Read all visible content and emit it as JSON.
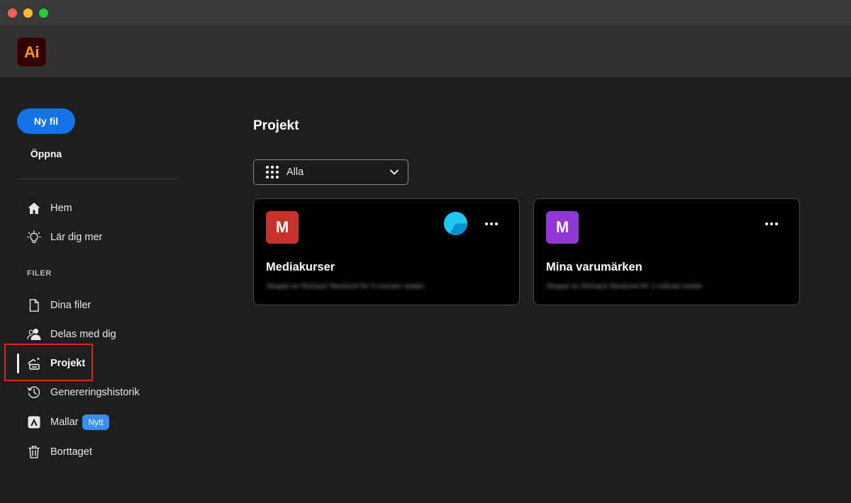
{
  "app": {
    "logo_text": "Ai",
    "brand_color": "#ff9a00",
    "accent_color": "#1473e6"
  },
  "sidebar": {
    "new_file_label": "Ny fil",
    "open_label": "Öppna",
    "nav_top": [
      {
        "label": "Hem",
        "icon": "home-icon"
      },
      {
        "label": "Lär dig mer",
        "icon": "lightbulb-icon"
      }
    ],
    "files_section_label": "FILER",
    "nav_files": [
      {
        "label": "Dina filer",
        "icon": "document-icon"
      },
      {
        "label": "Delas med dig",
        "icon": "people-icon"
      },
      {
        "label": "Projekt",
        "icon": "project-icon",
        "active": true
      },
      {
        "label": "Genereringshistorik",
        "icon": "history-icon"
      },
      {
        "label": "Mallar",
        "icon": "template-icon",
        "badge": "Nytt"
      },
      {
        "label": "Borttaget",
        "icon": "trash-icon"
      }
    ]
  },
  "main": {
    "title": "Projekt",
    "filter": {
      "label": "Alla",
      "icon": "grid-icon"
    },
    "projects": [
      {
        "initial": "M",
        "name": "Mediakurser",
        "subtitle": "Skapat av Richard Stenlund för 5 minuter sedan",
        "tile_color": "#c9322c",
        "shared_indicator": true,
        "menu_icon": "more-icon"
      },
      {
        "initial": "M",
        "name": "Mina varumärken",
        "subtitle": "Skapat av Richard Stenlund för 1 månad sedan",
        "tile_color": "#9038d6",
        "shared_indicator": false,
        "menu_icon": "more-icon"
      }
    ]
  }
}
